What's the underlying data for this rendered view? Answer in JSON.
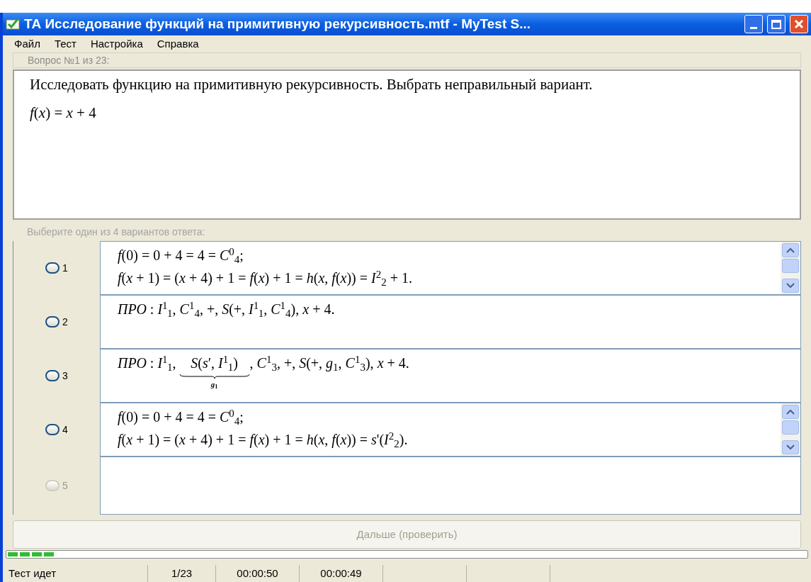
{
  "window": {
    "title": "ТА Исследование функций на примитивную рекурсивность.mtf - MyTest S..."
  },
  "menu": [
    "Файл",
    "Тест",
    "Настройка",
    "Справка"
  ],
  "question": {
    "header": "Вопрос №1 из 23:",
    "paragraphs": [
      "Исследовать функцию на примитивную рекурсивность. Выбрать неправильный вариант.",
      "*f*(*x*) = *x* + 4"
    ]
  },
  "answers_header": "Выберите один из 4 вариантов ответа:",
  "answers": [
    {
      "number": "1",
      "selected": false,
      "disabled": false,
      "scrollbar": true,
      "lines": [
        {
          "kind": "plain",
          "text": "*f*(0) = 0 + 4 = 4 = *C*$^{0}$$_{4}$;"
        },
        {
          "kind": "plain",
          "text": "*f*(*x* + 1) = (*x* + 4) + 1 = *f*(*x*) + 1 = *h*(*x*, *f*(*x*)) = *I*$^{2}$$_{2}$ + 1."
        }
      ]
    },
    {
      "number": "2",
      "selected": false,
      "disabled": false,
      "scrollbar": false,
      "lines": [
        {
          "kind": "plain",
          "text": "*ПРО* : *I*$^{1}$$_{1}$, *C*$^{1}$$_{4}$, +, *S*(+, *I*$^{1}$$_{1}$, *C*$^{1}$$_{4}$), *x* + 4."
        }
      ]
    },
    {
      "number": "3",
      "selected": false,
      "disabled": false,
      "scrollbar": false,
      "lines": [
        {
          "kind": "braced",
          "before": "*ПРО* : *I*$^{1}$$_{1}$,",
          "braced": "*S*(*s*′, *I*$^{1}$$_{1}$)",
          "label": "*g*$_{1}$",
          "after": ", *C*$^{1}$$_{3}$, +, *S*(+, *g*$_{1}$, *C*$^{1}$$_{3}$), *x* + 4."
        }
      ]
    },
    {
      "number": "4",
      "selected": false,
      "disabled": false,
      "scrollbar": true,
      "lines": [
        {
          "kind": "plain",
          "text": "*f*(0) = 0 + 4 = 4 = *C*$^{0}$$_{4}$;"
        },
        {
          "kind": "plain",
          "text": "*f*(*x* + 1) = (*x* + 4) + 1 = *f*(*x*) + 1 = *h*(*x*, *f*(*x*)) = *s*'(*I*$^{2}$$_{2}$)."
        }
      ]
    },
    {
      "number": "5",
      "selected": false,
      "disabled": true,
      "scrollbar": false
    }
  ],
  "next_button": {
    "label": "Дальше (проверить)",
    "disabled": true
  },
  "progress": {
    "level": 0.06
  },
  "status_bar": [
    "Тест идет",
    "1/23",
    "00:00:50",
    "00:00:49"
  ]
}
